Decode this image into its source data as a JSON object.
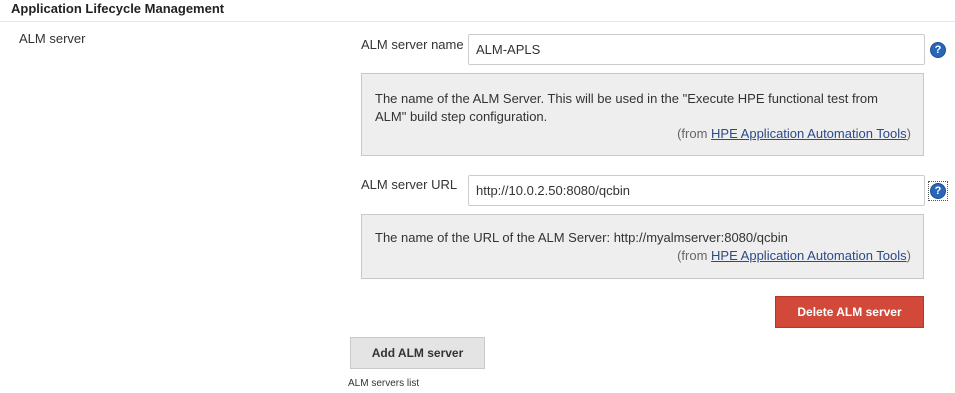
{
  "section": {
    "title": "Application Lifecycle Management"
  },
  "alm_server": {
    "label": "ALM server",
    "name_field": {
      "label": "ALM server name",
      "value": "ALM-APLS"
    },
    "name_help": {
      "text": "The name of the ALM Server. This will be used in the \"Execute HPE functional test from ALM\" build step configuration.",
      "from_prefix": "(from ",
      "from_link": "HPE Application Automation Tools",
      "from_suffix": ")"
    },
    "url_field": {
      "label": "ALM server URL",
      "value": "http://10.0.2.50:8080/qcbin"
    },
    "url_help": {
      "text": "The name of the URL of the ALM Server: http://myalmserver:8080/qcbin",
      "from_prefix": "(from ",
      "from_link": "HPE Application Automation Tools",
      "from_suffix": ")"
    },
    "help_icon_glyph": "?",
    "delete_label": "Delete ALM server"
  },
  "add_label": "Add ALM server",
  "list_caption": "ALM servers list",
  "colors": {
    "delete_button": "#d24939",
    "help_icon": "#2a66b8",
    "link": "#2b4a88"
  }
}
